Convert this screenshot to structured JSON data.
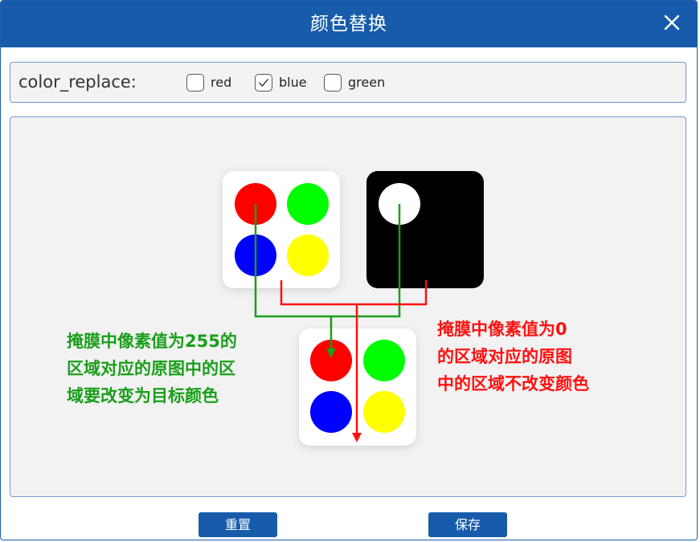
{
  "dialog": {
    "title": "颜色替换",
    "close_icon": "close-icon"
  },
  "options": {
    "label": "color_replace:",
    "checkboxes": [
      {
        "label": "red",
        "checked": false
      },
      {
        "label": "blue",
        "checked": true
      },
      {
        "label": "green",
        "checked": false
      }
    ]
  },
  "diagram": {
    "green_note": "掩膜中像素值为255的\n区域对应的原图中的区\n域要改变为目标颜色",
    "red_note": "掩膜中像素值为0\n的区域对应的原图\n中的区域不改变颜色",
    "colors": {
      "red": "#ff0000",
      "green": "#00ff00",
      "blue": "#0000ff",
      "yellow": "#ffff00",
      "arrow_green": "#1a9e1a",
      "arrow_red": "#ff1010"
    }
  },
  "buttons": {
    "reset": "重置",
    "save": "保存"
  },
  "theme": {
    "titlebar": "#175cab"
  }
}
